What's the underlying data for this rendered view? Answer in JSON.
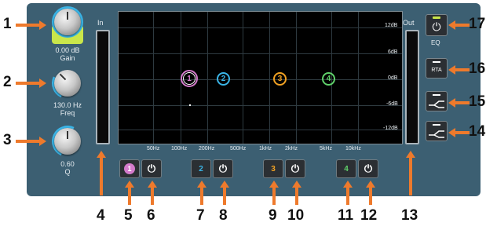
{
  "gain": {
    "value": "0.00 dB",
    "label": "Gain"
  },
  "freq": {
    "value": "130.0 Hz",
    "label": "Freq"
  },
  "q": {
    "value": "0.60",
    "label": "Q"
  },
  "meters": {
    "in_label": "In",
    "out_label": "Out"
  },
  "graph": {
    "freq_ticks": [
      "50Hz",
      "100Hz",
      "200Hz",
      "500Hz",
      "1kHz",
      "2kHz",
      "5kHz",
      "10kHz"
    ],
    "db_ticks": [
      "12dB",
      "6dB",
      "0dB",
      "-6dB",
      "-12dB"
    ]
  },
  "bands": [
    {
      "number": "1",
      "color": "#d37acb"
    },
    {
      "number": "2",
      "color": "#3ab4e6"
    },
    {
      "number": "3",
      "color": "#f2a223"
    },
    {
      "number": "4",
      "color": "#5fd16a"
    }
  ],
  "side_buttons": {
    "eq_label": "EQ",
    "rta_label": "RTA"
  },
  "callouts": [
    "1",
    "2",
    "3",
    "4",
    "5",
    "6",
    "7",
    "8",
    "9",
    "10",
    "11",
    "12",
    "13",
    "14",
    "15",
    "16",
    "17"
  ],
  "colors": {
    "panel": "#3c5f72",
    "accent": "#3ab4e6",
    "arrow": "#ee7a2c",
    "eq_led": "#c9e64a"
  }
}
